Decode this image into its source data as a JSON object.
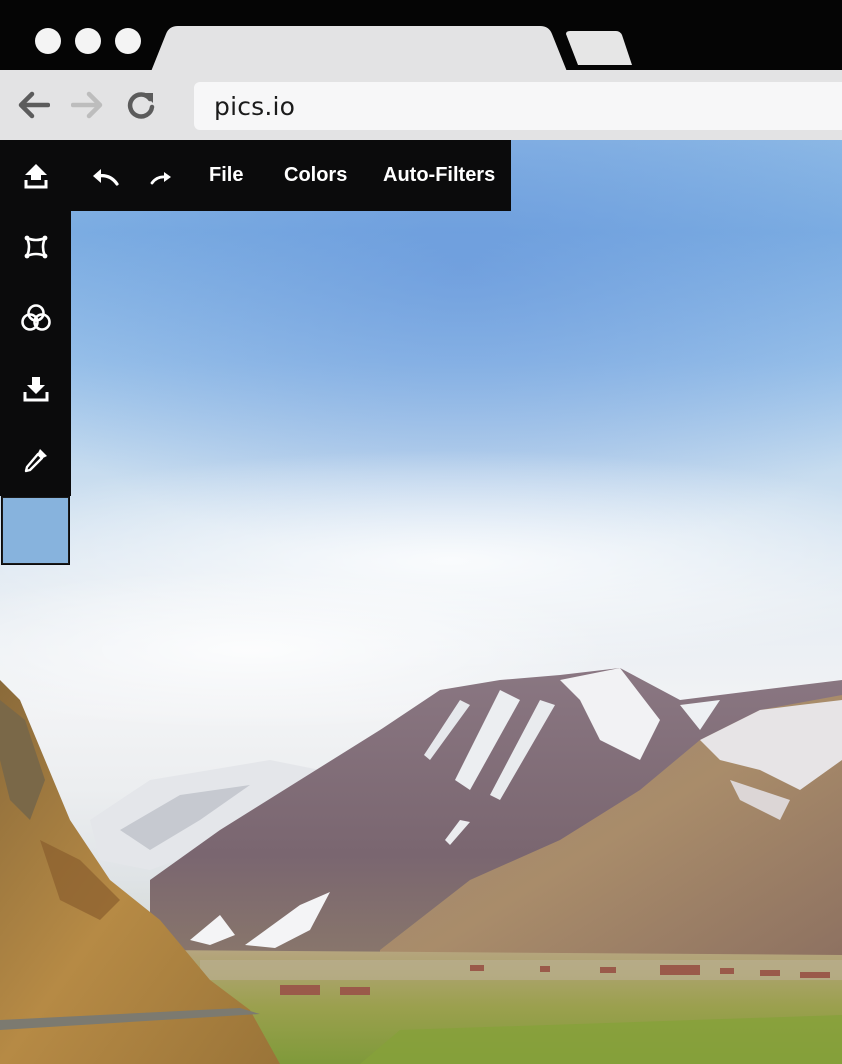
{
  "browser": {
    "address_bar": {
      "url": "pics.io"
    },
    "nav": {
      "back_icon": "arrow-left-icon",
      "forward_icon": "arrow-right-icon",
      "reload_icon": "reload-icon"
    }
  },
  "editor": {
    "side_toolbar": {
      "tools": [
        {
          "name": "upload",
          "icon": "upload-icon"
        },
        {
          "name": "crop",
          "icon": "crop-icon"
        },
        {
          "name": "color-channels",
          "icon": "channels-icon"
        },
        {
          "name": "download",
          "icon": "download-icon"
        },
        {
          "name": "eyedropper",
          "icon": "eyedropper-icon"
        }
      ],
      "picked_color": "#87b3dd"
    },
    "top_toolbar": {
      "undo_icon": "undo-icon",
      "redo_icon": "redo-icon",
      "menu": [
        "File",
        "Colors",
        "Auto-Filters"
      ]
    }
  },
  "colors": {
    "toolbar_bg": "#0b0b0c",
    "chrome_bg": "#e3e3e4",
    "titlebar_bg": "#050505"
  }
}
